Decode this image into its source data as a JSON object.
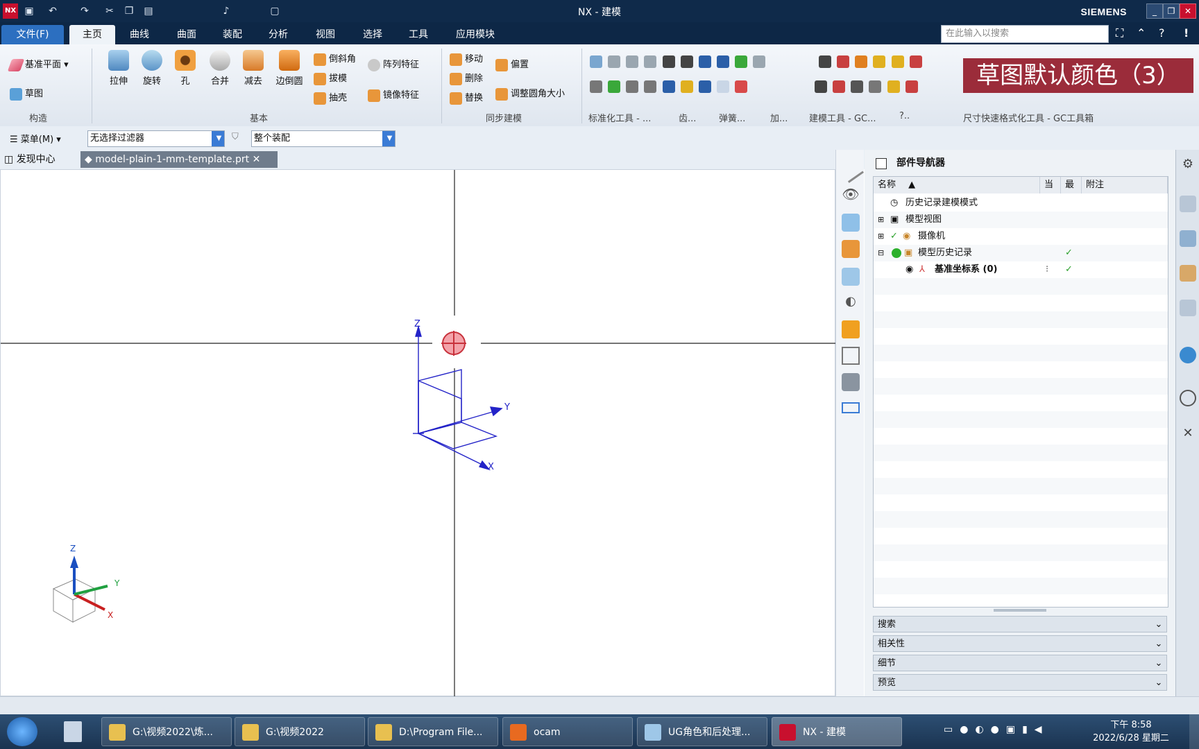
{
  "window": {
    "title": "NX - 建模",
    "brand": "SIEMENS"
  },
  "menu": {
    "file": "文件(F)",
    "tabs": [
      "主页",
      "曲线",
      "曲面",
      "装配",
      "分析",
      "视图",
      "选择",
      "工具",
      "应用模块"
    ]
  },
  "search": {
    "placeholder": "在此输入以搜索"
  },
  "ribbon": {
    "datum_plane": "基准平面",
    "sketch": "草图",
    "group_construct": "构造",
    "group_basic": "基本",
    "group_sync": "同步建模",
    "basic_buttons": [
      "拉伸",
      "旋转",
      "孔",
      "合并",
      "减去",
      "边倒圆"
    ],
    "basic_small": [
      "倒斜角",
      "拔模",
      "抽壳"
    ],
    "pattern": "阵列特征",
    "mirror": "镜像特征",
    "sync_small": [
      "移动",
      "删除",
      "替换"
    ],
    "offset": "偏置",
    "resize_blend": "调整圆角大小",
    "group_std": "标准化工具 - ...",
    "group_gear": "齿...",
    "group_spring": "弹簧...",
    "group_add": "加...",
    "group_model_gc": "建模工具 - GC...",
    "group_misc": "?..",
    "group_dim_gc": "尺寸快速格式化工具 - GC工具箱"
  },
  "overlay": {
    "text": "草图默认颜色（3）"
  },
  "filterbar": {
    "menu": "菜单(M)",
    "filter_value": "无选择过滤器",
    "scope_value": "整个装配"
  },
  "doctabs": {
    "discover": "发现中心",
    "file": "model-plain-1-mm-template.prt"
  },
  "viewport": {
    "axis_z": "Z",
    "axis_y": "Y",
    "axis_x": "X"
  },
  "navigator": {
    "title": "部件导航器",
    "columns": [
      "名称",
      "当",
      "最",
      "附注"
    ],
    "rows": [
      {
        "label": "历史记录建模模式"
      },
      {
        "label": "模型视图"
      },
      {
        "label": "摄像机"
      },
      {
        "label": "模型历史记录"
      },
      {
        "label": "基准坐标系 (0)"
      }
    ],
    "sections": [
      "搜索",
      "相关性",
      "细节",
      "预览"
    ]
  },
  "taskbar": {
    "items": [
      "G:\\视频2022\\炼...",
      "G:\\视频2022",
      "D:\\Program File...",
      "ocam",
      "UG角色和后处理...",
      "NX - 建模"
    ],
    "time": "下午 8:58",
    "date": "2022/6/28 星期二"
  },
  "colors": {
    "titlebar": "#0f2a4a",
    "file_tab": "#2c6fc0",
    "overlay": "#9b2c3a",
    "sketch_blue": "#2323c8"
  }
}
